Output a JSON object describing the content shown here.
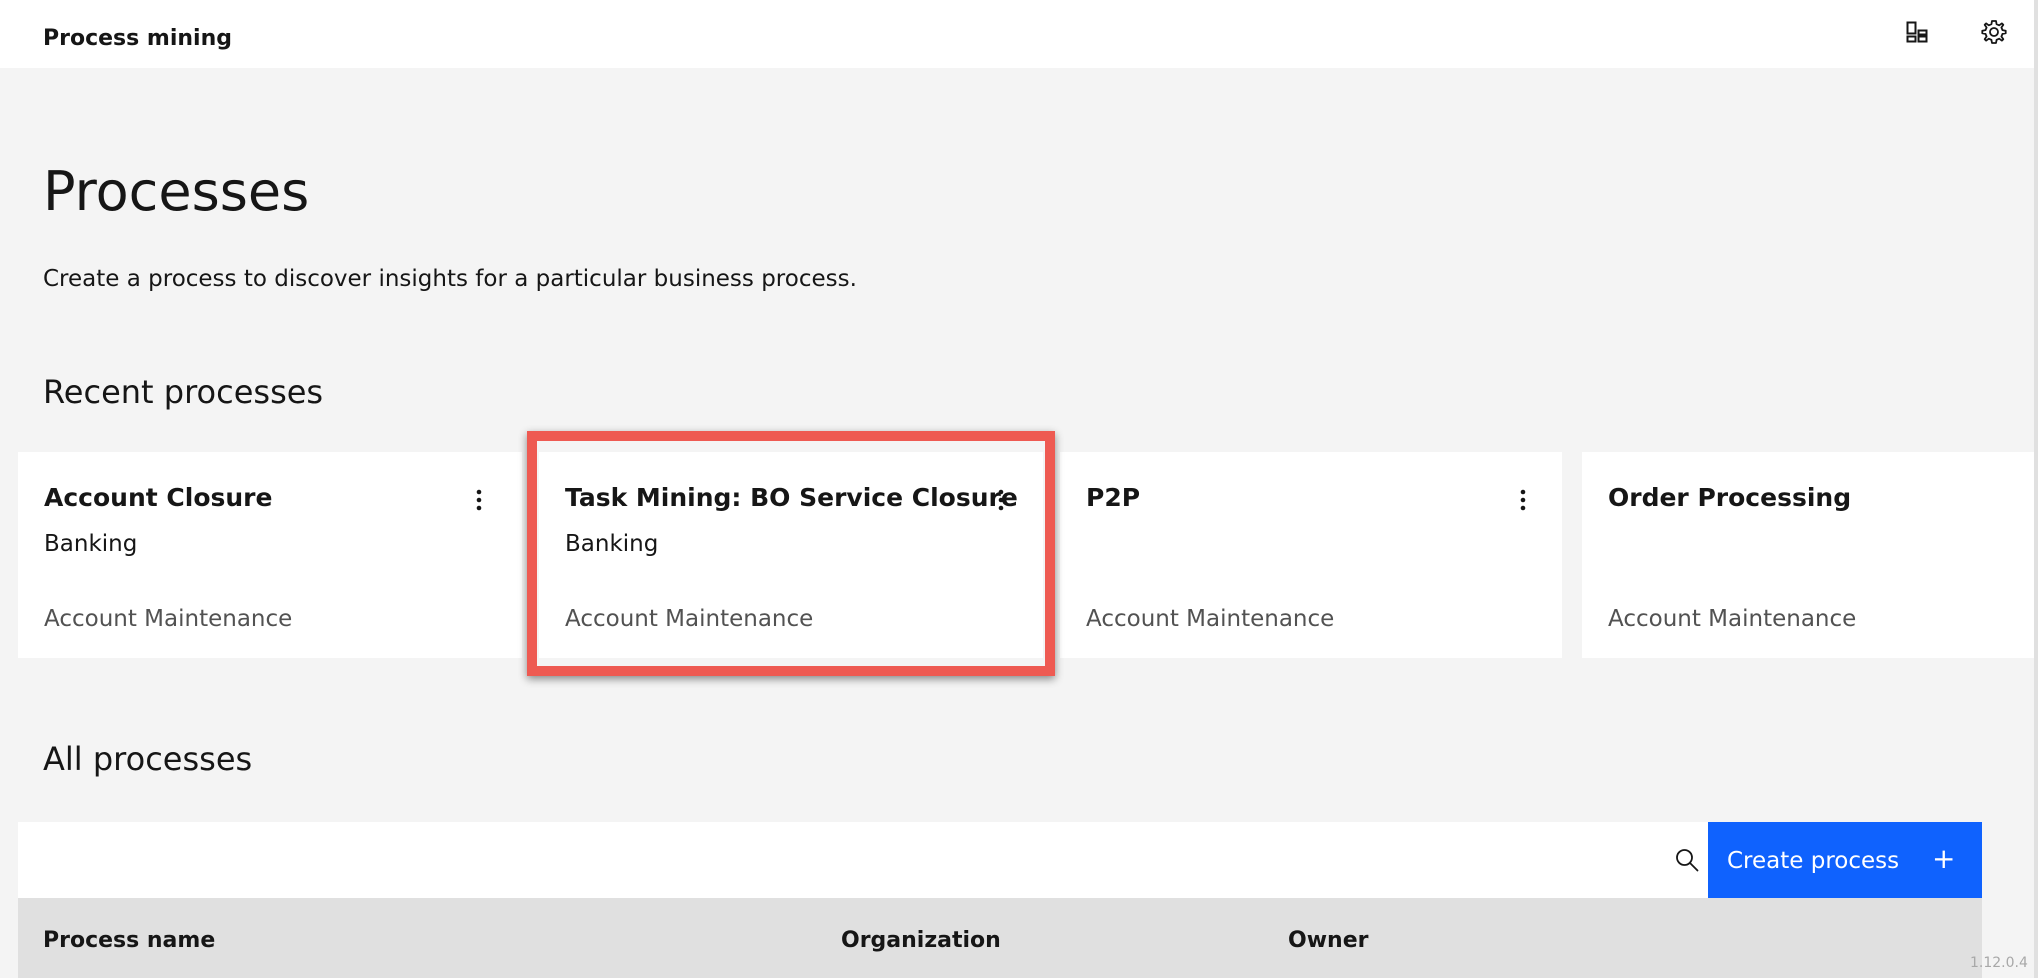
{
  "header": {
    "app_name": "Process mining",
    "icons": [
      "dashboard-icon",
      "settings-icon"
    ]
  },
  "page": {
    "title": "Processes",
    "description": "Create a process to discover insights for a particular business process."
  },
  "recent": {
    "title": "Recent processes",
    "cards": [
      {
        "name": "Account Closure",
        "organization": "Banking",
        "category": "Account Maintenance"
      },
      {
        "name": "Task Mining: BO Service Closure",
        "organization": "Banking",
        "category": "Account Maintenance"
      },
      {
        "name": "P2P",
        "organization": "",
        "category": "Account Maintenance"
      },
      {
        "name": "Order Processing",
        "organization": "",
        "category": "Account Maintenance"
      }
    ]
  },
  "all": {
    "title": "All processes",
    "create_label": "Create process",
    "create_icon": "+",
    "columns": [
      "Process name",
      "Organization",
      "Owner"
    ]
  },
  "version": "1.12.0.4",
  "colors": {
    "primary": "#0f62fe",
    "highlight": "#ee5a52",
    "background": "#f4f4f4"
  }
}
